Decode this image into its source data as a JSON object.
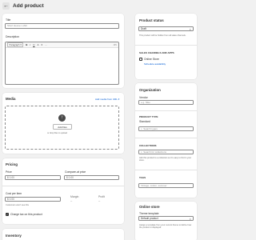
{
  "header": {
    "title": "Add product",
    "back_icon": "arrow-left-icon"
  },
  "main": {
    "title_label": "Title",
    "title_placeholder": "Short sleeve t-shirt",
    "description_label": "Description",
    "editor_toolbar": {
      "format": "Paragraph",
      "bold": "B",
      "italic": "I",
      "underline": "U",
      "color": "A",
      "align": "≡",
      "more": "···",
      "code": "</>"
    }
  },
  "media": {
    "heading": "Media",
    "add_from_url": "Add media from URL ▾",
    "add_files": "Add files",
    "drop_hint": "or drop files to upload"
  },
  "pricing": {
    "heading": "Pricing",
    "price_label": "Price",
    "price_value": "$ 0.00",
    "compare_label": "Compare-at price",
    "compare_value": "$ 0.00",
    "cost_label": "Cost per item",
    "cost_value": "$ 0.00",
    "cost_hint": "Customers won't see this",
    "margin_label": "Margin",
    "margin_value": "--",
    "profit_label": "Profit",
    "profit_value": "--",
    "charge_tax_label": "Charge tax on this product"
  },
  "inventory": {
    "heading": "Inventory"
  },
  "status": {
    "heading": "Product status",
    "value": "Draft",
    "hint": "This product will be hidden from all sales channels.",
    "channels_heading": "SALES CHANNELS AND APPS",
    "online_store": "Online Store",
    "schedule": "Schedule availability"
  },
  "organization": {
    "heading": "Organization",
    "vendor_label": "Vendor",
    "vendor_placeholder": "e.g. Nike",
    "type_heading": "PRODUCT TYPE",
    "type_value": "Standard",
    "type_placeholder": "Search types",
    "collections_heading": "COLLECTIONS",
    "collections_placeholder": "Search for collections",
    "collections_hint": "Add this product to a collection so it's easy to find in your store.",
    "tags_heading": "TAGS",
    "tags_placeholder": "Vintage, cotton, summer"
  },
  "online_store": {
    "heading": "Online store",
    "template_label": "Theme template",
    "template_value": "Default product",
    "template_hint": "Assign a template from your current theme to define how the product is displayed."
  },
  "colors": {
    "accent": "#005bd3",
    "background": "#f1f1f1",
    "surface": "#ffffff",
    "text": "#303030"
  }
}
